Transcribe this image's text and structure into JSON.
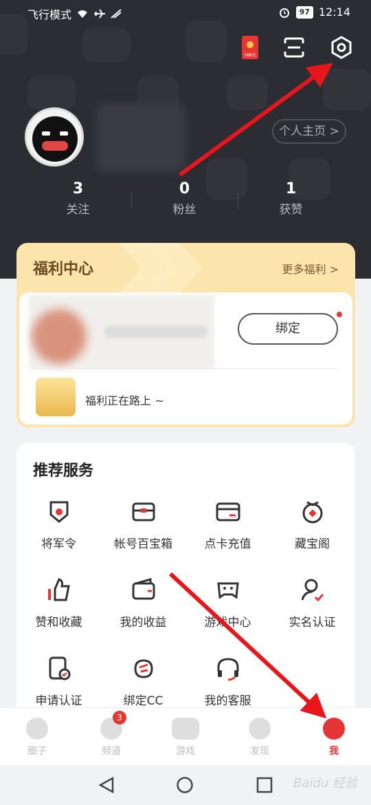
{
  "status": {
    "mode": "飞行模式",
    "battery": "97",
    "time": "12:14"
  },
  "header": {
    "redpacket_amount": "588元",
    "profile_button": "个人主页 >"
  },
  "stats": [
    {
      "value": "3",
      "label": "关注"
    },
    {
      "value": "0",
      "label": "粉丝"
    },
    {
      "value": "1",
      "label": "获赞"
    }
  ],
  "welfare": {
    "title": "福利中心",
    "more": "更多福利 >",
    "bind": "绑定",
    "status": "福利正在路上 ~"
  },
  "services": {
    "title": "推荐服务",
    "items": [
      {
        "label": "将军令",
        "icon": "shield-command-icon"
      },
      {
        "label": "帐号百宝箱",
        "icon": "treasure-box-icon"
      },
      {
        "label": "点卡充值",
        "icon": "card-icon"
      },
      {
        "label": "藏宝阁",
        "icon": "treasure-pavilion-icon"
      },
      {
        "label": "赞和收藏",
        "icon": "thumbs-up-icon"
      },
      {
        "label": "我的收益",
        "icon": "wallet-icon"
      },
      {
        "label": "游戏中心",
        "icon": "gamepad-icon"
      },
      {
        "label": "实名认证",
        "icon": "verify-user-icon"
      },
      {
        "label": "申请认证",
        "icon": "apply-certify-icon"
      },
      {
        "label": "绑定CC",
        "icon": "cc-bind-icon"
      },
      {
        "label": "我的客服",
        "icon": "headset-icon"
      }
    ]
  },
  "tabs": [
    {
      "label": "圈子"
    },
    {
      "label": "频道",
      "badge": "3"
    },
    {
      "label": "游戏"
    },
    {
      "label": "发现"
    },
    {
      "label": "我"
    }
  ],
  "watermark": "Baidu 经验"
}
